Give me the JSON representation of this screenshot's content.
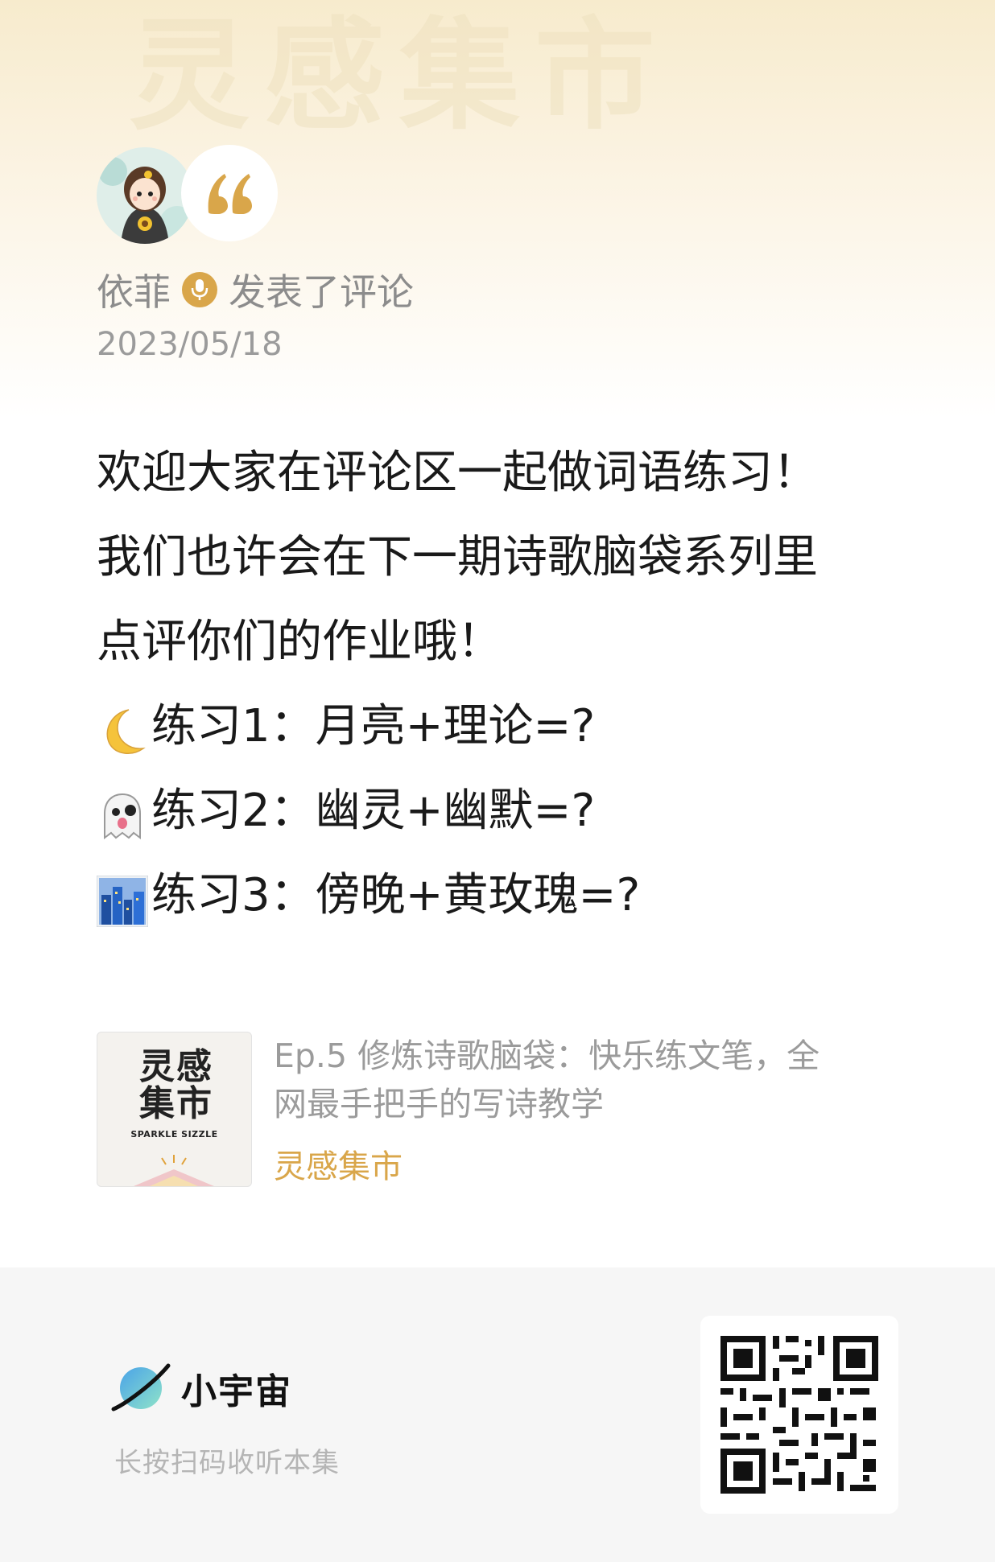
{
  "header": {
    "watermark": "灵感集市"
  },
  "post": {
    "author": "依菲",
    "action": "发表了评论",
    "date": "2023/05/18",
    "lines": [
      "欢迎大家在评论区一起做词语练习！",
      "我们也许会在下一期诗歌脑袋系列里",
      "点评你们的作业哦！"
    ],
    "exercises": [
      {
        "emoji": "crescent-moon-icon",
        "text": "练习1：月亮+理论=?"
      },
      {
        "emoji": "ghost-icon",
        "text": "练习2：幽灵+幽默=?"
      },
      {
        "emoji": "cityscape-at-dusk-icon",
        "text": "练习3：傍晚+黄玫瑰=?"
      }
    ]
  },
  "episode": {
    "cover_title": "灵感集市",
    "cover_subtitle": "SPARKLE SIZZLE",
    "title": "Ep.5 修炼诗歌脑袋：快乐练文笔，全网最手把手的写诗教学",
    "podcast": "灵感集市"
  },
  "footer": {
    "brand": "小宇宙",
    "hint": "长按扫码收听本集",
    "qr_icon": "qr-code-icon"
  },
  "colors": {
    "accent": "#d9a64a",
    "muted_text": "#9b9b9b",
    "body_text": "#1a1a1a",
    "footer_bg": "#f6f6f6"
  }
}
